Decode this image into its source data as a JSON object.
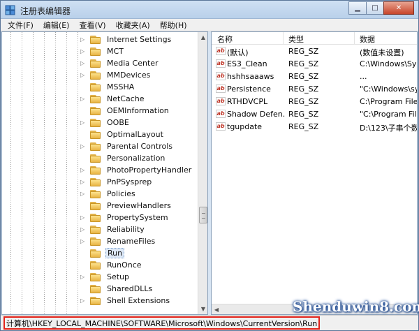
{
  "window": {
    "title": "注册表编辑器"
  },
  "menu": [
    "文件(F)",
    "编辑(E)",
    "查看(V)",
    "收藏夹(A)",
    "帮助(H)"
  ],
  "tree": {
    "items": [
      {
        "label": "Internet Settings",
        "expandable": true
      },
      {
        "label": "MCT",
        "expandable": true
      },
      {
        "label": "Media Center",
        "expandable": true
      },
      {
        "label": "MMDevices",
        "expandable": true
      },
      {
        "label": "MSSHA",
        "expandable": false
      },
      {
        "label": "NetCache",
        "expandable": true
      },
      {
        "label": "OEMInformation",
        "expandable": false
      },
      {
        "label": "OOBE",
        "expandable": true
      },
      {
        "label": "OptimalLayout",
        "expandable": false
      },
      {
        "label": "Parental Controls",
        "expandable": true
      },
      {
        "label": "Personalization",
        "expandable": false
      },
      {
        "label": "PhotoPropertyHandler",
        "expandable": true
      },
      {
        "label": "PnPSysprep",
        "expandable": true
      },
      {
        "label": "Policies",
        "expandable": true
      },
      {
        "label": "PreviewHandlers",
        "expandable": false
      },
      {
        "label": "PropertySystem",
        "expandable": true
      },
      {
        "label": "Reliability",
        "expandable": true
      },
      {
        "label": "RenameFiles",
        "expandable": true
      },
      {
        "label": "Run",
        "expandable": false,
        "selected": true
      },
      {
        "label": "RunOnce",
        "expandable": false
      },
      {
        "label": "Setup",
        "expandable": true
      },
      {
        "label": "SharedDLLs",
        "expandable": false
      },
      {
        "label": "Shell Extensions",
        "expandable": true
      }
    ]
  },
  "list": {
    "columns": [
      "名称",
      "类型",
      "数据"
    ],
    "rows": [
      {
        "name": "(默认)",
        "type": "REG_SZ",
        "data": "(数值未设置)"
      },
      {
        "name": "ES3_Clean",
        "type": "REG_SZ",
        "data": "C:\\Windows\\Sys"
      },
      {
        "name": "hshhsaaaws",
        "type": "REG_SZ",
        "data": "..."
      },
      {
        "name": "Persistence",
        "type": "REG_SZ",
        "data": "\"C:\\Windows\\sy"
      },
      {
        "name": "RTHDVCPL",
        "type": "REG_SZ",
        "data": "C:\\Program Files"
      },
      {
        "name": "Shadow Defen...",
        "type": "REG_SZ",
        "data": "\"C:\\Program File"
      },
      {
        "name": "tgupdate",
        "type": "REG_SZ",
        "data": "D:\\123\\子串个数"
      }
    ]
  },
  "status": {
    "path": "计算机\\HKEY_LOCAL_MACHINE\\SOFTWARE\\Microsoft\\Windows\\CurrentVersion\\Run"
  },
  "watermark": "Shenduwin8.com",
  "colors": {
    "highlight": "#e2231a",
    "frame": "#bfd4ea"
  }
}
